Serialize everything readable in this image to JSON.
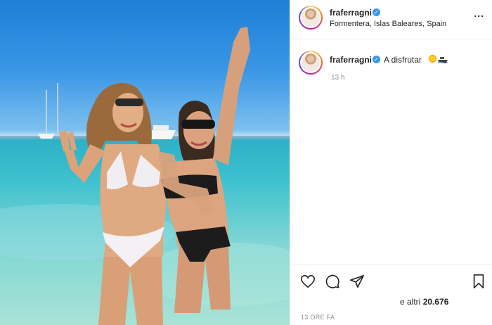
{
  "post": {
    "username": "fraferragni",
    "location": "Formentera, Islas Baleares, Spain",
    "more_label": "...",
    "verified_badge": "✓"
  },
  "comment": {
    "username": "fraferragni",
    "caption": "A disfrutar",
    "emojis": [
      "sun-emoji",
      "boat-emoji"
    ],
    "time": "13 h"
  },
  "actions": {
    "icons": [
      "heart-icon",
      "comment-icon",
      "share-icon",
      "bookmark-icon"
    ],
    "likes_prefix": "e altri",
    "likes_count": "20.676",
    "posted_ago": "13 ORE FA"
  },
  "colors": {
    "verified": "#3897f0",
    "muted": "#8e8e8e",
    "text": "#262626"
  }
}
